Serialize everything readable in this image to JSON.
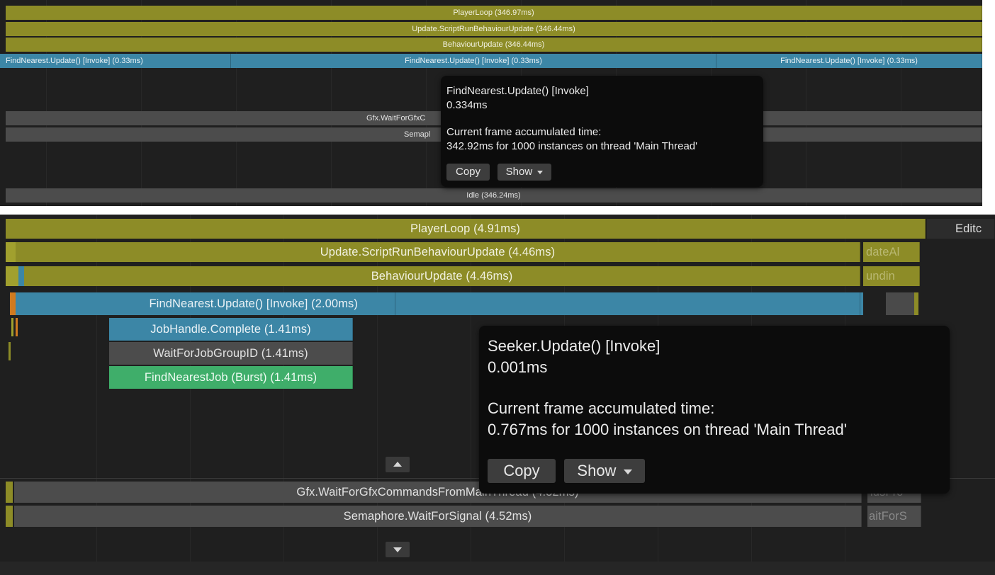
{
  "top": {
    "player_loop": "PlayerLoop (346.97ms)",
    "script_run": "Update.ScriptRunBehaviourUpdate (346.44ms)",
    "behaviour_update": "BehaviourUpdate (346.44ms)",
    "find_nearest_left": "FindNearest.Update() [Invoke] (0.33ms)",
    "find_nearest_mid": "FindNearest.Update() [Invoke] (0.33ms)",
    "find_nearest_right": "FindNearest.Update() [Invoke] (0.33ms)",
    "gfx_wait": "Gfx.WaitForGfxC",
    "semaphore": "Semapl",
    "idle": "Idle (346.24ms)",
    "tooltip": {
      "name": "FindNearest.Update() [Invoke]",
      "time": "0.334ms",
      "accum_label": "Current frame accumulated time:",
      "accum_value": "342.92ms for 1000 instances on thread 'Main Thread'",
      "copy": "Copy",
      "show": "Show"
    }
  },
  "bottom": {
    "player_loop": "PlayerLoop (4.91ms)",
    "editor_cut": "Editc",
    "script_run": "Update.ScriptRunBehaviourUpdate (4.46ms)",
    "script_run_side": "dateAl",
    "behaviour_update": "BehaviourUpdate (4.46ms)",
    "behaviour_side": "undin",
    "find_nearest": "FindNearest.Update() [Invoke] (2.00ms)",
    "job_handle": "JobHandle.Complete (1.41ms)",
    "wait_job_group": "WaitForJobGroupID (1.41ms)",
    "find_nearest_job": "FindNearestJob (Burst) (1.41ms)",
    "gfx_wait": "Gfx.WaitForGfxCommandsFromMainThread (4.52ms)",
    "gfx_side": "ldsFro",
    "semaphore": "Semaphore.WaitForSignal (4.52ms)",
    "semaphore_side": "aitForS",
    "tooltip": {
      "name": "Seeker.Update() [Invoke]",
      "time": "0.001ms",
      "accum_label": "Current frame accumulated time:",
      "accum_value": "0.767ms for 1000 instances on thread 'Main Thread'",
      "copy": "Copy",
      "show": "Show"
    }
  },
  "colors": {
    "olive": "#8d8c27",
    "blue": "#3c86a6",
    "grey": "#4c4c4c",
    "green": "#3fae6a",
    "background": "#1f1f1f",
    "tooltip": "#0c0c0c"
  },
  "icons": {
    "expand_up": "triangle-up",
    "expand_down": "triangle-down",
    "show_dropdown": "triangle-down"
  }
}
